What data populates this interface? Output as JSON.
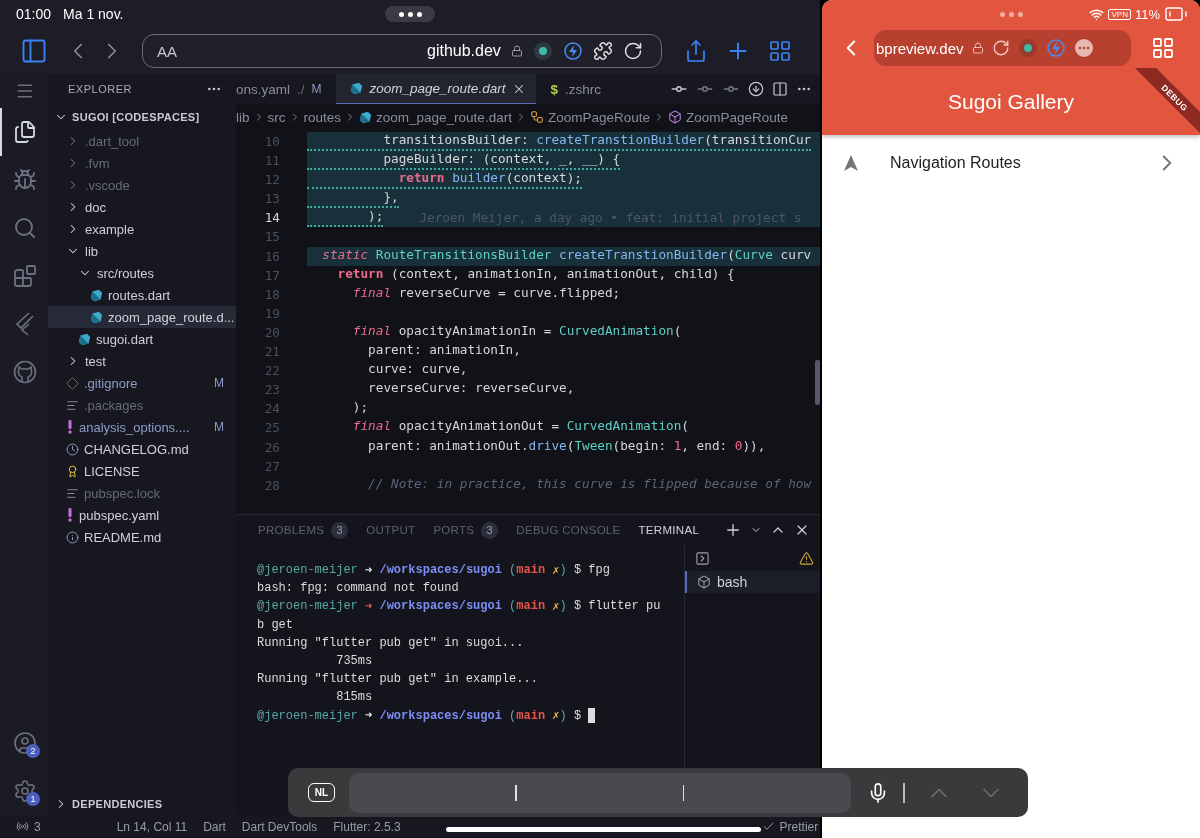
{
  "ios_status": {
    "time": "01:00",
    "date": "Ma 1 nov."
  },
  "safari": {
    "text_size": "AA",
    "domain": "github.dev"
  },
  "activity_bar": {
    "items": [
      {
        "kind": "menu",
        "selected": false
      },
      {
        "kind": "explorer",
        "selected": true
      },
      {
        "kind": "debug",
        "selected": false
      },
      {
        "kind": "search",
        "selected": false
      },
      {
        "kind": "extensions",
        "selected": false
      },
      {
        "kind": "flutter",
        "selected": false
      },
      {
        "kind": "github",
        "selected": false
      }
    ],
    "accounts_badge": "2",
    "settings_badge": "1"
  },
  "explorer": {
    "title": "EXPLORER",
    "section": "SUGOI [CODESPACES]",
    "footer": "DEPENDENCIES",
    "tree": [
      {
        "name": ".dart_tool",
        "kind": "folder",
        "expanded": false,
        "ignored": true,
        "selected": false
      },
      {
        "name": ".fvm",
        "kind": "folder",
        "expanded": false,
        "ignored": true,
        "selected": false
      },
      {
        "name": ".vscode",
        "kind": "folder",
        "expanded": false,
        "ignored": true,
        "selected": false
      },
      {
        "name": "doc",
        "kind": "folder",
        "expanded": false,
        "ignored": false,
        "selected": false
      },
      {
        "name": "example",
        "kind": "folder",
        "expanded": false,
        "ignored": false,
        "selected": false
      },
      {
        "name": "lib",
        "kind": "folder",
        "expanded": true,
        "ignored": false,
        "selected": false,
        "children": [
          {
            "name": "src/routes",
            "kind": "folder",
            "expanded": true,
            "ignored": false,
            "selected": false,
            "children": [
              {
                "name": "routes.dart",
                "kind": "dart",
                "ignored": false,
                "selected": false
              },
              {
                "name": "zoom_page_route.d...",
                "kind": "dart",
                "ignored": false,
                "selected": true
              }
            ]
          },
          {
            "name": "sugoi.dart",
            "kind": "dart",
            "ignored": false,
            "selected": false
          }
        ]
      },
      {
        "name": "test",
        "kind": "folder",
        "expanded": false,
        "ignored": false,
        "selected": false
      },
      {
        "name": ".gitignore",
        "kind": "git",
        "badge": "M",
        "ignored": false,
        "selected": false
      },
      {
        "name": ".packages",
        "kind": "text",
        "ignored": true,
        "selected": false
      },
      {
        "name": "analysis_options....",
        "kind": "yaml",
        "badge": "M",
        "ignored": false,
        "selected": false
      },
      {
        "name": "CHANGELOG.md",
        "kind": "changelog",
        "ignored": false,
        "selected": false
      },
      {
        "name": "LICENSE",
        "kind": "license",
        "ignored": false,
        "selected": false
      },
      {
        "name": "pubspec.lock",
        "kind": "text",
        "ignored": true,
        "selected": false
      },
      {
        "name": "pubspec.yaml",
        "kind": "yaml",
        "ignored": false,
        "selected": false
      },
      {
        "name": "README.md",
        "kind": "info",
        "ignored": false,
        "selected": false
      }
    ]
  },
  "editor_tabs": [
    {
      "name": "ons.yaml",
      "path": "./",
      "badge": "M",
      "kind": "plain",
      "selected": false
    },
    {
      "name": "zoom_page_route.dart",
      "kind": "dart",
      "selected": true
    },
    {
      "name": ".zshrc",
      "kind": "shell",
      "glyph": "$",
      "selected": false
    }
  ],
  "breadcrumbs": [
    {
      "text": "lib",
      "kind": "folder"
    },
    {
      "text": "src",
      "kind": "folder"
    },
    {
      "text": "routes",
      "kind": "folder"
    },
    {
      "text": "zoom_page_route.dart",
      "kind": "dart"
    },
    {
      "text": "ZoomPageRoute",
      "kind": "class"
    },
    {
      "text": "ZoomPageRoute",
      "kind": "constructor"
    }
  ],
  "code": {
    "lines": [
      {
        "number": "10",
        "current": false,
        "highlighted": true,
        "warning": true,
        "tokens": [
          {
            "text": "          transitionsBuilder: ",
            "kind": "plain"
          },
          {
            "text": "createTranstionBuilder",
            "kind": "func"
          },
          {
            "text": "(transitionCur",
            "kind": "plain"
          }
        ]
      },
      {
        "number": "11",
        "current": false,
        "highlighted": true,
        "warning": true,
        "tokens": [
          {
            "text": "          pageBuilder: (context, _, __) {",
            "kind": "plain"
          }
        ]
      },
      {
        "number": "12",
        "current": false,
        "highlighted": true,
        "warning": true,
        "tokens": [
          {
            "text": "            return ",
            "kind": "control"
          },
          {
            "text": "builder",
            "kind": "func"
          },
          {
            "text": "(context);",
            "kind": "plain"
          }
        ]
      },
      {
        "number": "13",
        "current": false,
        "highlighted": true,
        "warning": true,
        "tokens": [
          {
            "text": "          },",
            "kind": "plain"
          }
        ]
      },
      {
        "number": "14",
        "current": true,
        "highlighted": true,
        "warning": true,
        "tokens": [
          {
            "text": "        );",
            "kind": "plain"
          }
        ],
        "blame": "Jeroen Meijer, a day ago • feat: initial project s"
      },
      {
        "number": "15",
        "current": false,
        "highlighted": false
      },
      {
        "number": "16",
        "current": false,
        "highlighted": true,
        "warning": false,
        "tokens": [
          {
            "text": "  static ",
            "kind": "keyword"
          },
          {
            "text": "RouteTransitionsBuilder ",
            "kind": "type"
          },
          {
            "text": "createTranstionBuilder",
            "kind": "func"
          },
          {
            "text": "(",
            "kind": "plain"
          },
          {
            "text": "Curve",
            "kind": "type"
          },
          {
            "text": " curv",
            "kind": "plain"
          }
        ]
      },
      {
        "number": "17",
        "current": false,
        "highlighted": false,
        "warning": false,
        "tokens": [
          {
            "text": "    return",
            "kind": "control"
          },
          {
            "text": " (context, animationIn, animationOut, child) {",
            "kind": "plain"
          }
        ]
      },
      {
        "number": "18",
        "current": false,
        "highlighted": false,
        "warning": false,
        "tokens": [
          {
            "text": "      final",
            "kind": "keyword"
          },
          {
            "text": " reverseCurve = curve.flipped;",
            "kind": "plain"
          }
        ]
      },
      {
        "number": "19",
        "current": false,
        "highlighted": false
      },
      {
        "number": "20",
        "current": false,
        "highlighted": false,
        "warning": false,
        "tokens": [
          {
            "text": "      final",
            "kind": "keyword"
          },
          {
            "text": " opacityAnimationIn = ",
            "kind": "plain"
          },
          {
            "text": "CurvedAnimation",
            "kind": "type"
          },
          {
            "text": "(",
            "kind": "plain"
          }
        ]
      },
      {
        "number": "21",
        "current": false,
        "highlighted": false,
        "warning": false,
        "tokens": [
          {
            "text": "        parent: animationIn,",
            "kind": "plain"
          }
        ]
      },
      {
        "number": "22",
        "current": false,
        "highlighted": false,
        "warning": false,
        "tokens": [
          {
            "text": "        curve: curve,",
            "kind": "plain"
          }
        ]
      },
      {
        "number": "23",
        "current": false,
        "highlighted": false,
        "warning": false,
        "tokens": [
          {
            "text": "        reverseCurve: reverseCurve,",
            "kind": "plain"
          }
        ]
      },
      {
        "number": "24",
        "current": false,
        "highlighted": false,
        "warning": false,
        "tokens": [
          {
            "text": "      );",
            "kind": "plain"
          }
        ]
      },
      {
        "number": "25",
        "current": false,
        "highlighted": false,
        "warning": false,
        "tokens": [
          {
            "text": "      final",
            "kind": "keyword"
          },
          {
            "text": " opacityAnimationOut = ",
            "kind": "plain"
          },
          {
            "text": "CurvedAnimation",
            "kind": "type"
          },
          {
            "text": "(",
            "kind": "plain"
          }
        ]
      },
      {
        "number": "26",
        "current": false,
        "highlighted": false,
        "warning": false,
        "tokens": [
          {
            "text": "        parent: animationOut.",
            "kind": "plain"
          },
          {
            "text": "drive",
            "kind": "func"
          },
          {
            "text": "(",
            "kind": "plain"
          },
          {
            "text": "Tween",
            "kind": "type"
          },
          {
            "text": "(begin: ",
            "kind": "plain"
          },
          {
            "text": "1",
            "kind": "number"
          },
          {
            "text": ", end: ",
            "kind": "plain"
          },
          {
            "text": "0",
            "kind": "number"
          },
          {
            "text": ")),",
            "kind": "plain"
          }
        ]
      },
      {
        "number": "27",
        "current": false,
        "highlighted": false
      },
      {
        "number": "28",
        "current": false,
        "highlighted": false,
        "warning": false,
        "tokens": [
          {
            "text": "        // Note: in practice, this curve is flipped because of how",
            "kind": "comment"
          }
        ]
      }
    ]
  },
  "panel_tabs": [
    {
      "label": "PROBLEMS",
      "count": "3",
      "selected": false
    },
    {
      "label": "OUTPUT",
      "selected": false
    },
    {
      "label": "PORTS",
      "count": "3",
      "selected": false
    },
    {
      "label": "DEBUG CONSOLE",
      "selected": false
    },
    {
      "label": "TERMINAL",
      "selected": true
    }
  ],
  "terminal": {
    "lines": [
      {
        "segments": [
          {
            "text": "@jeroen-meijer",
            "kind": "user"
          },
          {
            "text": " ➜ ",
            "kind": "arrow"
          },
          {
            "text": "/workspaces/sugoi",
            "kind": "path"
          },
          {
            "text": " (",
            "kind": "paren"
          },
          {
            "text": "main",
            "kind": "branch"
          },
          {
            "text": " ✗",
            "kind": "dirty"
          },
          {
            "text": ")",
            "kind": "paren"
          },
          {
            "text": " $ fpg",
            "kind": "plain"
          }
        ]
      },
      {
        "segments": [
          {
            "text": "bash: fpg: command not found",
            "kind": "plain"
          }
        ]
      },
      {
        "segments": [
          {
            "text": "@jeroen-meijer",
            "kind": "user"
          },
          {
            "text": " ➜ ",
            "kind": "arrow-error"
          },
          {
            "text": "/workspaces/sugoi",
            "kind": "path"
          },
          {
            "text": " (",
            "kind": "paren"
          },
          {
            "text": "main",
            "kind": "branch"
          },
          {
            "text": " ✗",
            "kind": "dirty"
          },
          {
            "text": ")",
            "kind": "paren"
          },
          {
            "text": " $ flutter pu",
            "kind": "plain"
          }
        ]
      },
      {
        "segments": [
          {
            "text": "b get",
            "kind": "plain"
          }
        ]
      },
      {
        "segments": [
          {
            "text": "Running \"flutter pub get\" in sugoi...",
            "kind": "plain"
          }
        ]
      },
      {
        "segments": [
          {
            "text": "           735ms",
            "kind": "plain"
          }
        ]
      },
      {
        "segments": [
          {
            "text": "Running \"flutter pub get\" in example...",
            "kind": "plain"
          }
        ]
      },
      {
        "segments": [
          {
            "text": "           815ms",
            "kind": "plain"
          }
        ]
      },
      {
        "segments": [
          {
            "text": "@jeroen-meijer",
            "kind": "user"
          },
          {
            "text": " ➜ ",
            "kind": "arrow"
          },
          {
            "text": "/workspaces/sugoi",
            "kind": "path"
          },
          {
            "text": " (",
            "kind": "paren"
          },
          {
            "text": "main",
            "kind": "branch"
          },
          {
            "text": " ✗",
            "kind": "dirty"
          },
          {
            "text": ")",
            "kind": "paren"
          },
          {
            "text": " $ ",
            "kind": "plain"
          }
        ]
      }
    ],
    "sessions": [
      {
        "label": "bash",
        "selected": true
      }
    ]
  },
  "status_bar": [
    {
      "text": "3",
      "kind": "ports"
    },
    {
      "text": "Ln 14, Col 11",
      "kind": "plain"
    },
    {
      "text": "Dart",
      "kind": "plain"
    },
    {
      "text": "Dart DevTools",
      "kind": "plain"
    },
    {
      "text": "Flutter: 2.5.3",
      "kind": "plain"
    },
    {
      "text": "Prettier",
      "kind": "check"
    }
  ],
  "keyboard_bar": {
    "language": "NL",
    "up_disabled": true,
    "down_disabled": true
  },
  "preview": {
    "status": {
      "vpn": "VPN",
      "battery": "11%"
    },
    "url": "bpreview.dev",
    "title": "Sugoi Gallery",
    "banner": "DEBUG",
    "items": [
      {
        "label": "Navigation Routes"
      }
    ]
  }
}
